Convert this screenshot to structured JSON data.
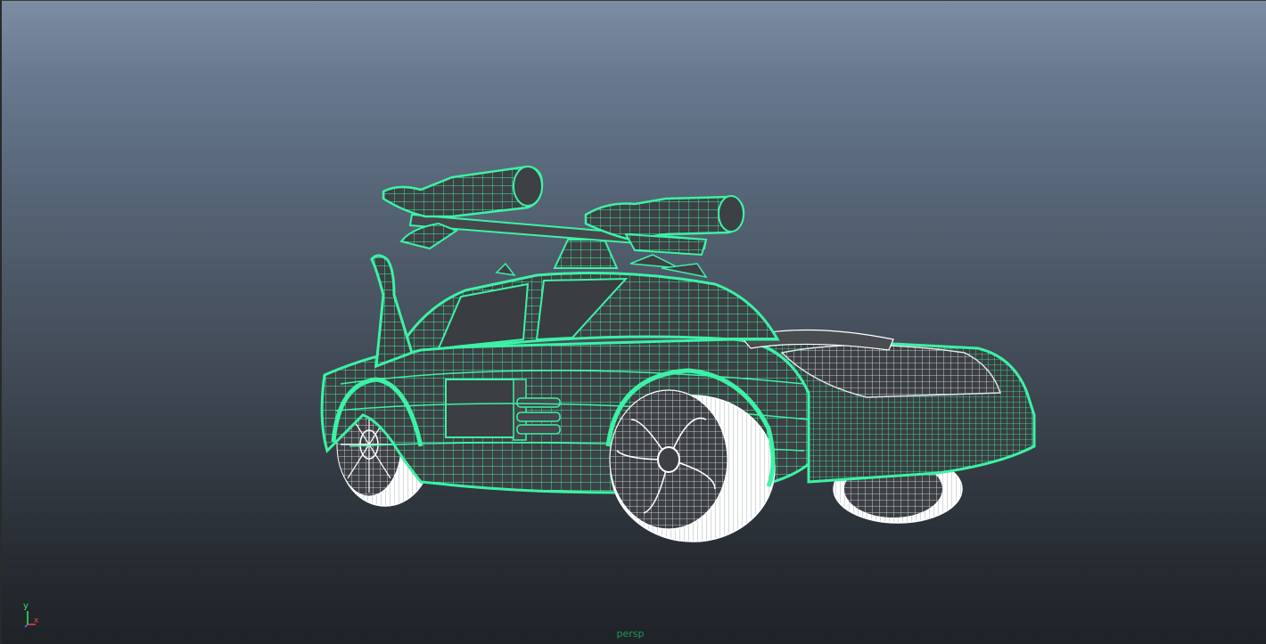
{
  "viewport": {
    "camera_name": "persp",
    "wire_color": "#3cf2a6",
    "selected_wire_color": "#3cf2a6",
    "unselected_wire_color": "#ffffff",
    "shade_color": "#3d4044"
  },
  "axis_gizmo": {
    "y_label": "y",
    "x_label": "x",
    "y_color": "#2ee86a",
    "x_color": "#ff3b3b",
    "z_color": "#4d7cff"
  }
}
